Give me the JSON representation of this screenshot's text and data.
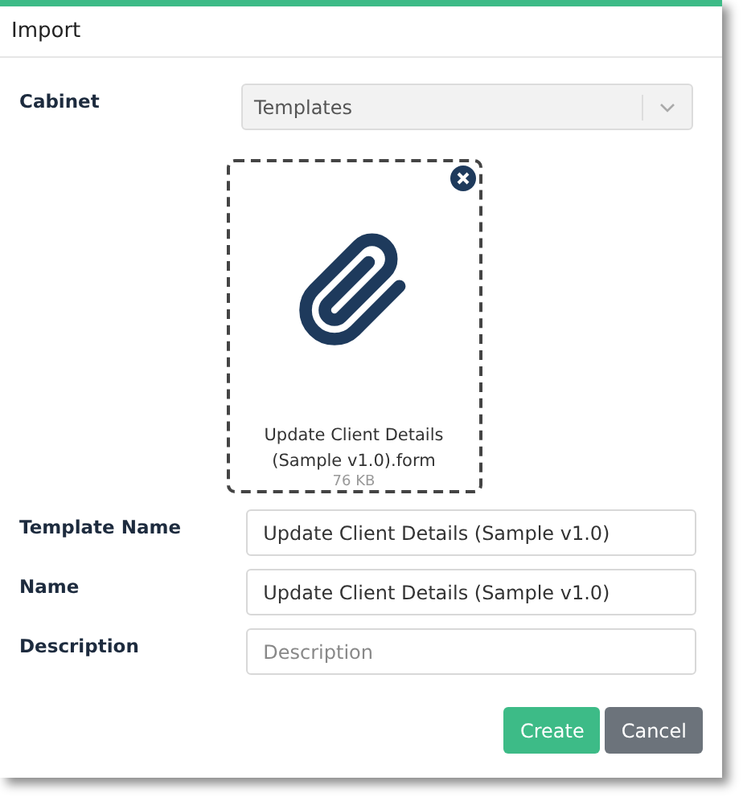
{
  "dialog": {
    "title": "Import"
  },
  "cabinet": {
    "label": "Cabinet",
    "value": "Templates",
    "disabled": true
  },
  "file": {
    "name": "Update Client Details (Sample v1.0).form",
    "size": "76 KB"
  },
  "fields": [
    {
      "label": "Template Name",
      "value": "Update Client Details (Sample v1.0)"
    },
    {
      "label": "Name",
      "value": "Update Client Details (Sample v1.0)"
    },
    {
      "label": "Description",
      "placeholder": "Description"
    }
  ],
  "buttons": [
    {
      "label": "Create",
      "kind": "primary"
    },
    {
      "label": "Cancel",
      "kind": "secondary"
    }
  ]
}
